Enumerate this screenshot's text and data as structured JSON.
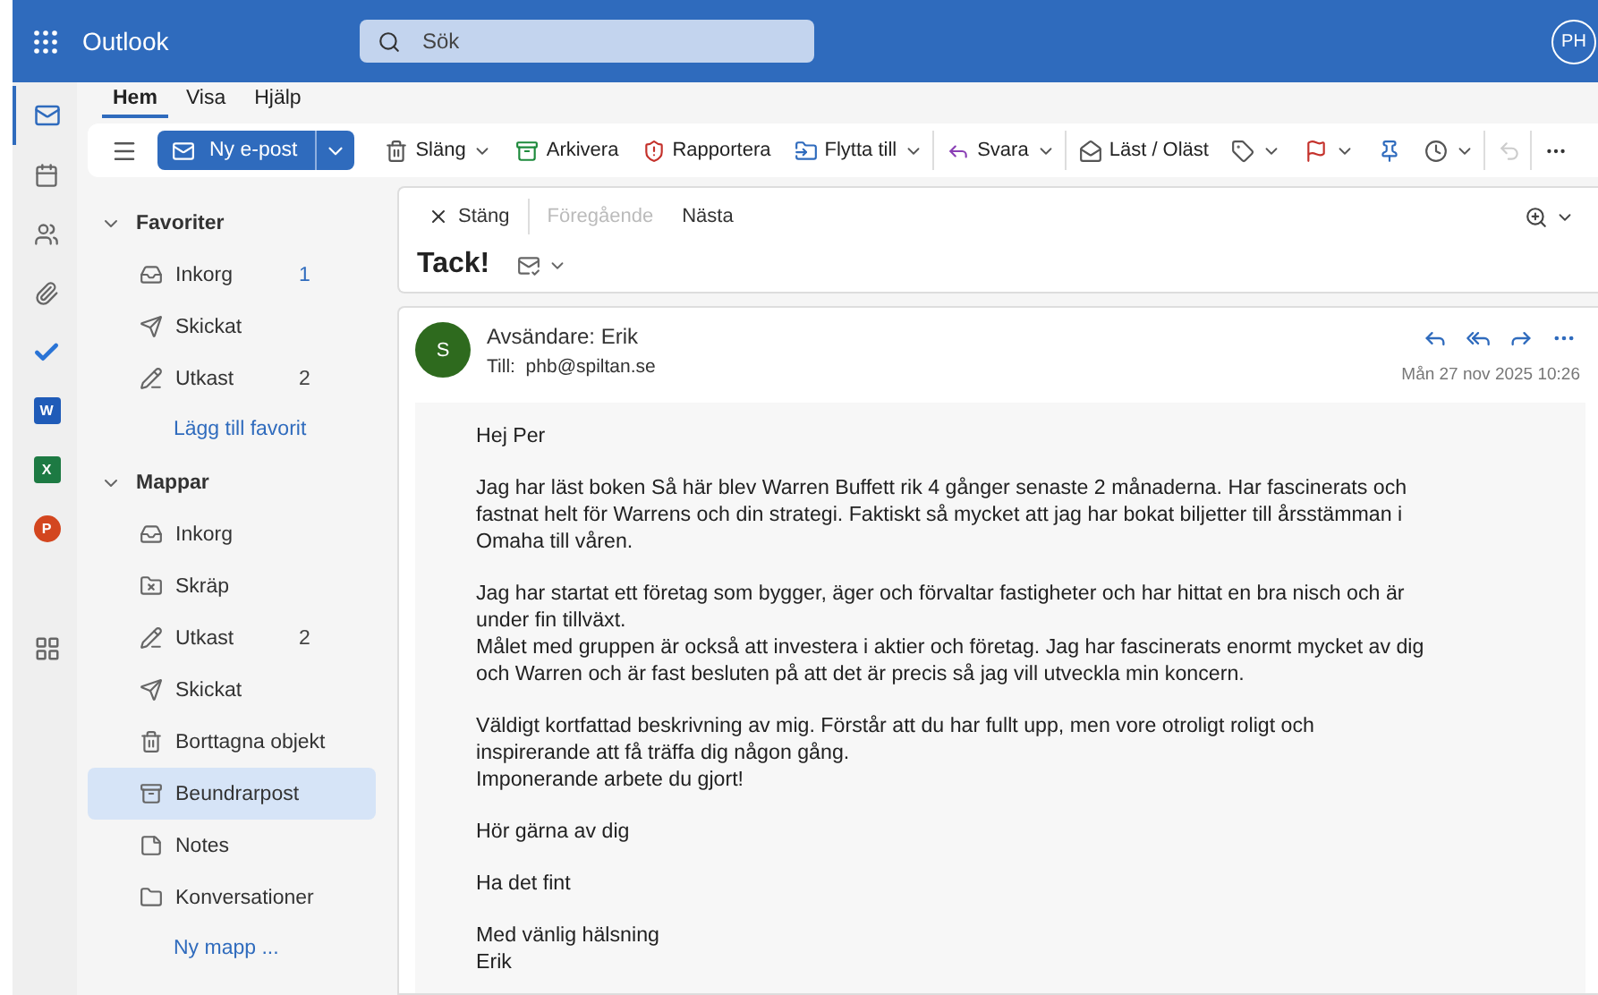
{
  "app": {
    "name": "Outlook",
    "search_placeholder": "Sök",
    "avatar": "PH"
  },
  "rail": [
    {
      "kind": "mail",
      "selected": true
    },
    {
      "kind": "calendar",
      "selected": false
    },
    {
      "kind": "people",
      "selected": false
    },
    {
      "kind": "files",
      "selected": false
    },
    {
      "kind": "todo",
      "selected": false
    },
    {
      "kind": "word",
      "glyph": "W",
      "selected": false
    },
    {
      "kind": "excel",
      "glyph": "X",
      "selected": false
    },
    {
      "kind": "powerpoint",
      "glyph": "P",
      "selected": false
    },
    {
      "kind": "apps",
      "selected": false
    }
  ],
  "tabs": [
    {
      "label": "Hem",
      "selected": true
    },
    {
      "label": "Visa",
      "selected": false
    },
    {
      "label": "Hjälp",
      "selected": false
    }
  ],
  "ribbon": {
    "new_mail": "Ny e-post",
    "actions": [
      {
        "kind": "delete",
        "label": "Släng",
        "dropdown": true,
        "divider": false
      },
      {
        "kind": "archive",
        "label": "Arkivera",
        "dropdown": false,
        "divider": false
      },
      {
        "kind": "report",
        "label": "Rapportera",
        "dropdown": false,
        "divider": false
      },
      {
        "kind": "move",
        "label": "Flytta till",
        "dropdown": true,
        "divider": true
      },
      {
        "kind": "reply",
        "label": "Svara",
        "dropdown": true,
        "divider": true
      },
      {
        "kind": "read",
        "label": "Läst / Oläst",
        "dropdown": false,
        "divider": false
      },
      {
        "kind": "tag",
        "dropdown": true,
        "divider": false
      },
      {
        "kind": "flag",
        "dropdown": true,
        "divider": false
      },
      {
        "kind": "pin",
        "dropdown": false,
        "divider": false
      },
      {
        "kind": "snooze",
        "dropdown": true,
        "divider": true
      },
      {
        "kind": "undo",
        "dropdown": false,
        "divider": true,
        "disabled": true
      },
      {
        "kind": "more",
        "dropdown": false,
        "divider": false
      }
    ]
  },
  "folder_groups": [
    {
      "title": "Favoriter",
      "expanded": true,
      "items": [
        {
          "kind": "inbox",
          "label": "Inkorg",
          "count": "1",
          "unread": true,
          "selected": false
        },
        {
          "kind": "sent",
          "label": "Skickat",
          "selected": false
        },
        {
          "kind": "drafts",
          "label": "Utkast",
          "count": "2",
          "unread": false,
          "selected": false
        }
      ],
      "link": "Lägg till favorit"
    },
    {
      "title": "Mappar",
      "expanded": true,
      "items": [
        {
          "kind": "inbox",
          "label": "Inkorg",
          "selected": false
        },
        {
          "kind": "junk",
          "label": "Skräp",
          "selected": false
        },
        {
          "kind": "drafts",
          "label": "Utkast",
          "count": "2",
          "unread": false,
          "selected": false
        },
        {
          "kind": "sent",
          "label": "Skickat",
          "selected": false
        },
        {
          "kind": "deleted",
          "label": "Borttagna objekt",
          "selected": false
        },
        {
          "kind": "archive",
          "label": "Beundrarpost",
          "selected": true
        },
        {
          "kind": "notes",
          "label": "Notes",
          "selected": false
        },
        {
          "kind": "folder",
          "label": "Konversationer",
          "selected": false
        }
      ],
      "link": "Ny mapp ..."
    }
  ],
  "message": {
    "nav": {
      "close": "Stäng",
      "previous": {
        "label": "Föregående",
        "disabled": true
      },
      "next": {
        "label": "Nästa",
        "disabled": false
      }
    },
    "subject": "Tack!",
    "sender": {
      "initial": "S",
      "from": "Avsändare: Erik",
      "to_label": "Till:",
      "to": "phb@spiltan.se",
      "date": "Mån 27 nov 2025 10:26"
    },
    "body": [
      [
        "Hej Per"
      ],
      [
        "Jag har läst boken Så här blev Warren Buffett rik 4 gånger senaste 2 månaderna. Har fascinerats och",
        "fastnat helt för Warrens och din strategi. Faktiskt så mycket att jag har bokat biljetter till årsstämman i",
        "Omaha till våren."
      ],
      [
        "Jag har startat ett företag som bygger, äger och förvaltar fastigheter och har hittat en bra nisch och är",
        "under fin tillväxt.",
        "Målet med gruppen är också att investera i aktier och företag. Jag har fascinerats enormt mycket av dig",
        "och Warren och är fast besluten på att det är precis så jag vill utveckla min koncern."
      ],
      [
        "Väldigt kortfattad beskrivning av mig. Förstår att du har fullt upp, men vore otroligt roligt och",
        "inspirerande att få träffa dig någon gång.",
        "Imponerande arbete du gjort!"
      ],
      [
        "Hör gärna av dig"
      ],
      [
        "Ha det fint"
      ],
      [
        "Med vänlig hälsning",
        "Erik"
      ]
    ]
  }
}
